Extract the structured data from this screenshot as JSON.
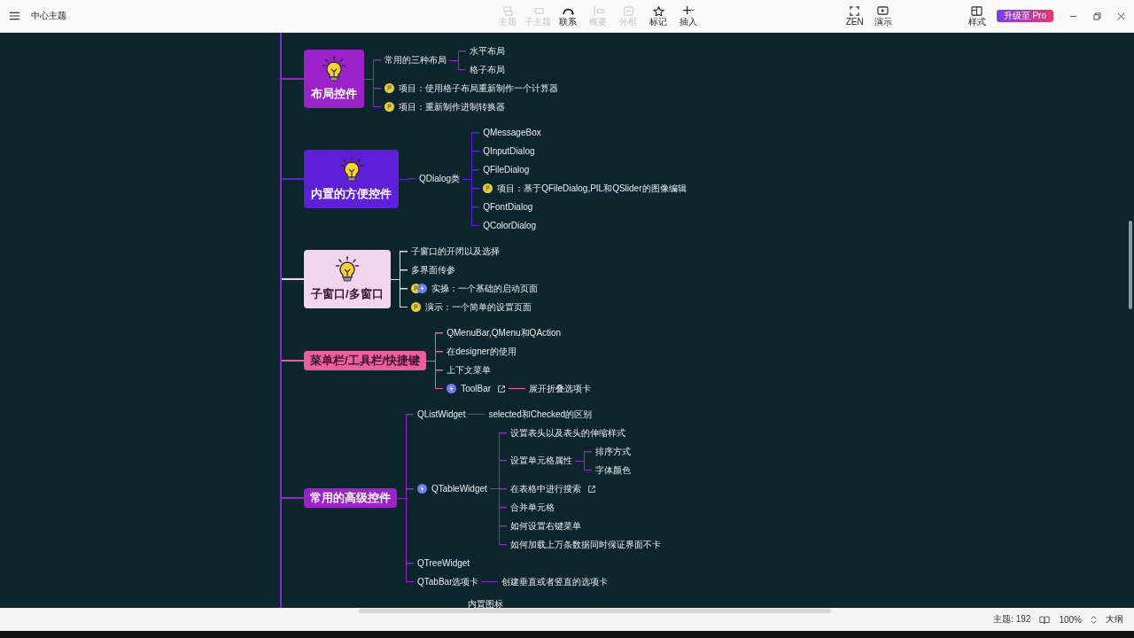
{
  "window": {
    "title": "中心主题"
  },
  "toolbar": [
    {
      "label": "主题",
      "kind": "topic",
      "disabled": true
    },
    {
      "label": "子主题",
      "kind": "subtopic",
      "disabled": true
    },
    {
      "label": "联系",
      "kind": "relation",
      "disabled": false
    },
    {
      "label": "概要",
      "kind": "summary",
      "disabled": true
    },
    {
      "label": "外框",
      "kind": "boundary",
      "disabled": true
    },
    {
      "label": "标记",
      "kind": "marker",
      "disabled": false
    },
    {
      "label": "插入",
      "kind": "insert",
      "disabled": false
    }
  ],
  "right_tools": [
    {
      "label": "ZEN",
      "kind": "zen"
    },
    {
      "label": "演示",
      "kind": "present"
    }
  ],
  "style_button": "样式",
  "upgrade_button": "升级至 Pro",
  "branches": [
    {
      "title": "布局控件",
      "kind": "card",
      "color": "#9a22c8",
      "children": [
        {
          "text": "常用的三种布局",
          "children": [
            {
              "text": "水平布局"
            },
            {
              "text": "格子布局"
            }
          ]
        },
        {
          "text": "项目：使用格子布局重新制作一个计算器",
          "markers": [
            {
              "kind": "flag"
            }
          ]
        },
        {
          "text": "项目：重新制作进制转换器",
          "markers": [
            {
              "kind": "flag"
            }
          ]
        }
      ]
    },
    {
      "title": "内置的方便控件",
      "kind": "card",
      "color": "#5d20d8",
      "children": [
        {
          "text": "QDialog类",
          "children": [
            {
              "text": "QMessageBox"
            },
            {
              "text": "QInputDialog"
            },
            {
              "text": "QFileDialog"
            },
            {
              "text": "项目：基于QFileDialog,PIL和QSlider的图像编辑",
              "markers": [
                {
                  "kind": "flag"
                }
              ]
            },
            {
              "text": "QFontDialog"
            },
            {
              "text": "QColorDialog"
            }
          ]
        }
      ]
    },
    {
      "title": "子窗口/多窗口",
      "kind": "card",
      "color": "#f1d5ec",
      "children": [
        {
          "text": "子窗口的开闭以及选择"
        },
        {
          "text": "多界面传参"
        },
        {
          "text": "实操：一个基础的启动页面",
          "markers": [
            {
              "kind": "flag"
            },
            {
              "kind": "bolt"
            }
          ]
        },
        {
          "text": "演示：一个简单的设置页面",
          "markers": [
            {
              "kind": "flag"
            }
          ]
        }
      ]
    },
    {
      "title": "菜单栏/工具栏/快捷键",
      "kind": "tag",
      "color": "#ea5f9c",
      "children": [
        {
          "text": "QMenuBar,QMenu和QAction"
        },
        {
          "text": "在designer的使用"
        },
        {
          "text": "上下文菜单"
        },
        {
          "text": "ToolBar",
          "markers": [
            {
              "kind": "bolt"
            }
          ],
          "link": true,
          "children": [
            {
              "text": "展开折叠选项卡"
            }
          ]
        }
      ]
    },
    {
      "title": "常用的高级控件",
      "kind": "tag",
      "color": "#9a22c8",
      "children": [
        {
          "text": "QListWidget",
          "children": [
            {
              "text": "selected和Checked的区别"
            }
          ]
        },
        {
          "text": "QTableWidget",
          "markers": [
            {
              "kind": "bolt"
            }
          ],
          "children": [
            {
              "text": "设置表头以及表头的伸缩样式"
            },
            {
              "text": "设置单元格属性",
              "children": [
                {
                  "text": "排序方式"
                },
                {
                  "text": "字体颜色"
                }
              ]
            },
            {
              "text": "在表格中进行搜索",
              "link": true
            },
            {
              "text": "合并单元格"
            },
            {
              "text": "如何设置右键菜单"
            },
            {
              "text": "如何加载上万条数据同时保证界面不卡"
            }
          ]
        },
        {
          "text": "QTreeWidget"
        },
        {
          "text": "QTabBar选项卡",
          "children": [
            {
              "text": "创建垂直或者竖直的选项卡"
            }
          ]
        }
      ]
    }
  ],
  "cut_item": "内置图标",
  "status_bar": {
    "topics": "主题: 192",
    "zoom": "100%",
    "outline": "大纲"
  }
}
